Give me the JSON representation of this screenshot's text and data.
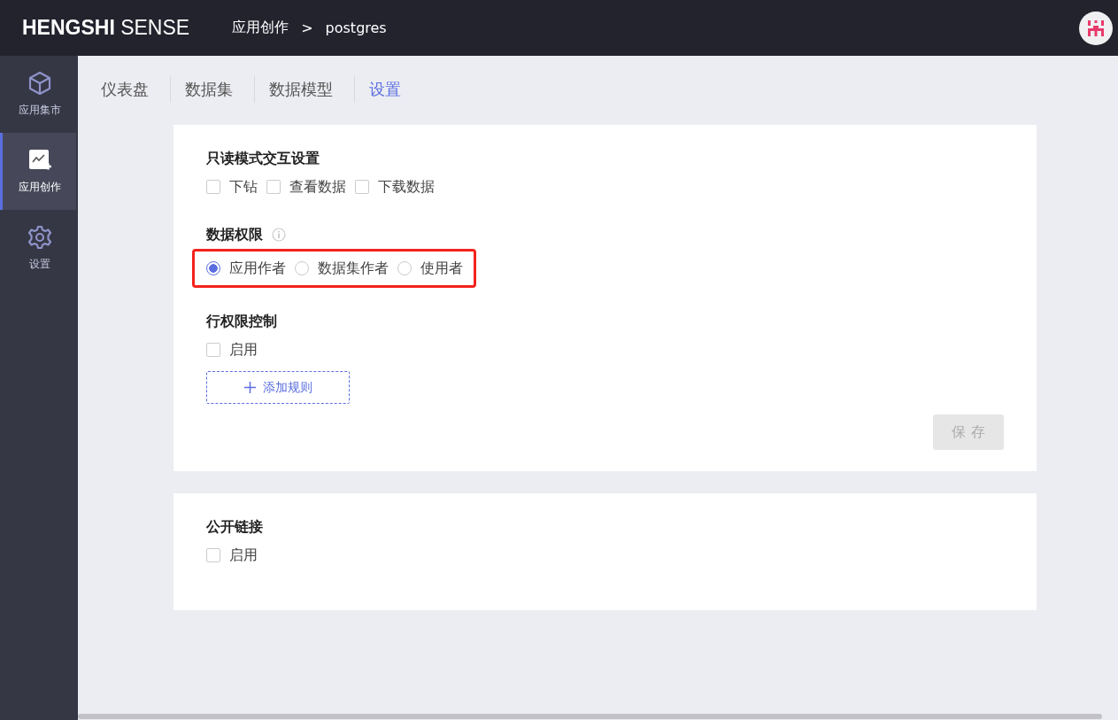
{
  "header": {
    "logo_bold": "HENGSHI",
    "logo_light": "SENSE",
    "breadcrumb": [
      {
        "label": "应用创作"
      },
      {
        "label": "postgres"
      }
    ],
    "breadcrumb_separator": ">"
  },
  "sidebar": {
    "items": [
      {
        "label": "应用集市",
        "selected": false
      },
      {
        "label": "应用创作",
        "selected": true
      },
      {
        "label": "设置",
        "selected": false
      }
    ]
  },
  "tabs": [
    {
      "label": "仪表盘",
      "selected": false
    },
    {
      "label": "数据集",
      "selected": false
    },
    {
      "label": "数据模型",
      "selected": false
    },
    {
      "label": "设置",
      "selected": true
    }
  ],
  "cards": [
    {
      "sections": [
        {
          "title": "只读模式交互设置",
          "kind": "checkboxes",
          "options": [
            {
              "label": "下钻",
              "checked": false
            },
            {
              "label": "查看数据",
              "checked": false
            },
            {
              "label": "下载数据",
              "checked": false
            }
          ]
        },
        {
          "title": "数据权限",
          "info": true,
          "kind": "radios",
          "highlighted": true,
          "options": [
            {
              "label": "应用作者",
              "selected": true
            },
            {
              "label": "数据集作者",
              "selected": false
            },
            {
              "label": "使用者",
              "selected": false
            }
          ]
        },
        {
          "title": "行权限控制",
          "kind": "checkboxes",
          "options": [
            {
              "label": "启用",
              "checked": false
            }
          ],
          "add_button": "添加规则"
        }
      ],
      "save_button": {
        "label": "保 存",
        "disabled": true
      }
    },
    {
      "sections": [
        {
          "title": "公开链接",
          "kind": "checkboxes",
          "options": [
            {
              "label": "启用",
              "checked": false
            }
          ]
        }
      ]
    }
  ]
}
